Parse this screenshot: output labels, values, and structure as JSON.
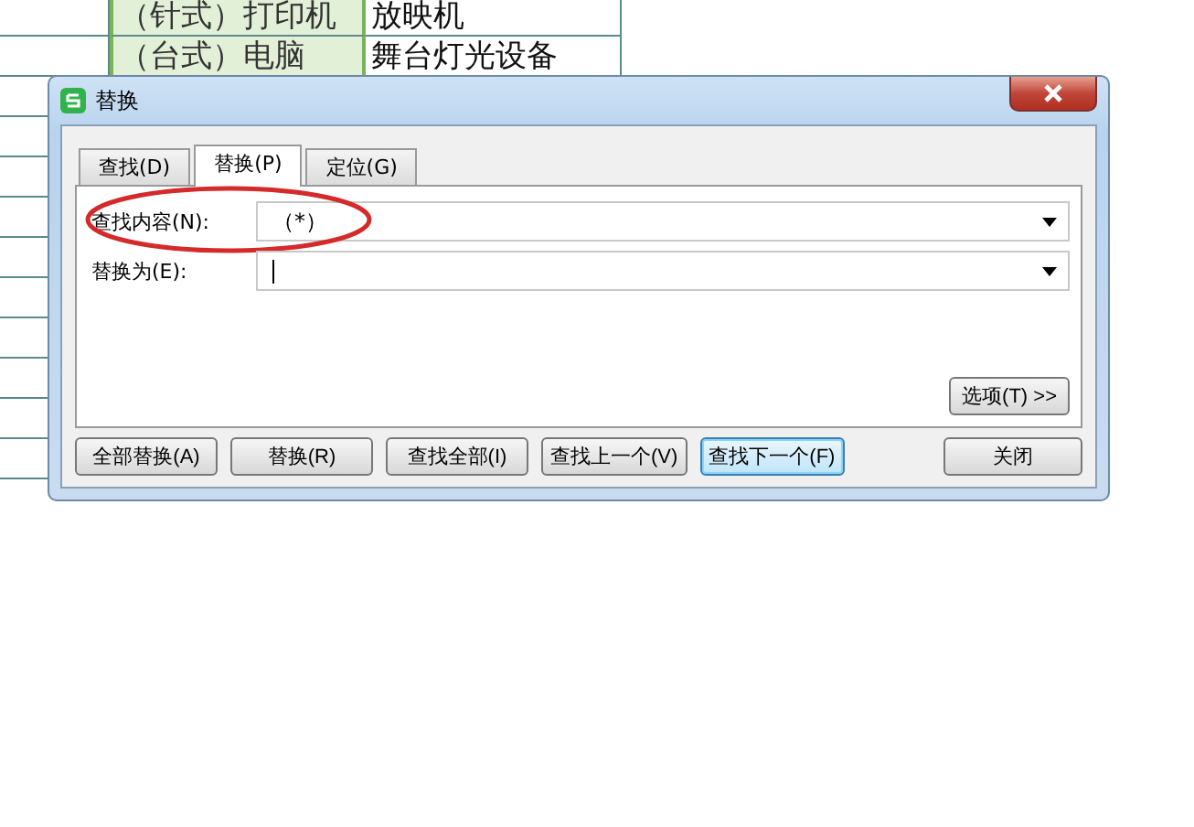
{
  "sheet": {
    "rows": [
      {
        "cells": [
          "（针式）打印机",
          "放映机"
        ]
      },
      {
        "cells": [
          "（台式）电脑",
          "舞台灯光设备"
        ]
      }
    ]
  },
  "dialog": {
    "title": "替换",
    "tabs": [
      {
        "label": "查找(D)",
        "selected": false
      },
      {
        "label": "替换(P)",
        "selected": true
      },
      {
        "label": "定位(G)",
        "selected": false
      }
    ],
    "fields": [
      {
        "label": "查找内容(N):",
        "value": "（*）",
        "focused": false,
        "annotated": true
      },
      {
        "label": "替换为(E):",
        "focused": true,
        "annotated": false
      }
    ],
    "options_button": "选项(T) >>",
    "buttons": [
      {
        "label": "全部替换(A)",
        "default": false
      },
      {
        "label": "替换(R)",
        "default": false
      },
      {
        "label": "查找全部(I)",
        "default": false
      },
      {
        "label": "查找上一个(V)",
        "default": false
      },
      {
        "label": "查找下一个(F)",
        "default": true
      },
      {
        "label": "关闭",
        "default": false
      }
    ]
  }
}
